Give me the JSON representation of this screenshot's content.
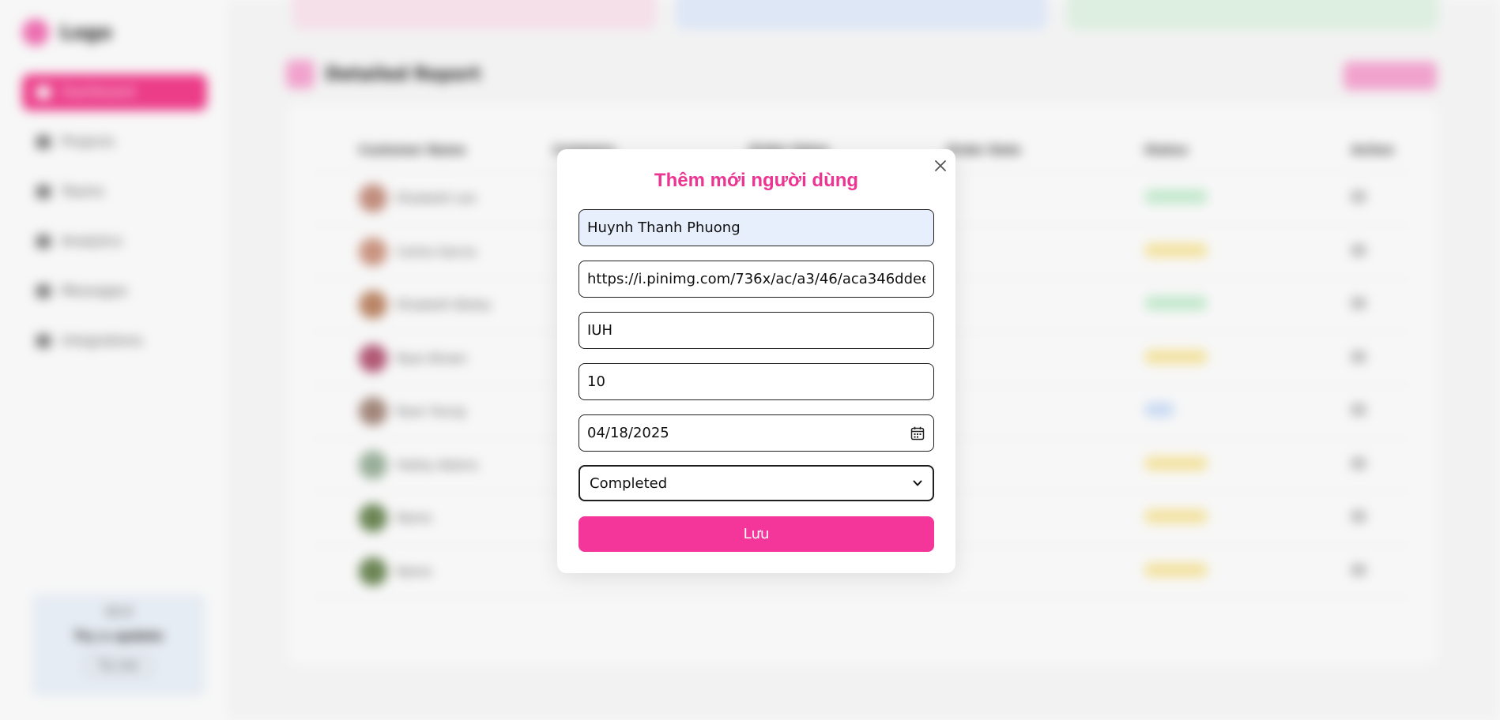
{
  "background": {
    "logo_text": "Logo",
    "nav_items": [
      "Dashboard",
      "Projects",
      "Teams",
      "Analytics",
      "Messages",
      "Integrations"
    ],
    "promo": {
      "title": "V2.0",
      "subtitle": "Try a update",
      "button": "Try now"
    },
    "section_title": "Detailed Report",
    "columns": [
      "",
      "Customer Name",
      "Company",
      "Order Value",
      "Order Date",
      "Status",
      "Action"
    ],
    "rows": [
      {
        "name": "Elizabeth Lee",
        "status": "green"
      },
      {
        "name": "Carlos Garcia",
        "status": "yellow"
      },
      {
        "name": "Elizabeth Bailey",
        "status": "green"
      },
      {
        "name": "Ryan Brown",
        "status": "yellow"
      },
      {
        "name": "Ryan Young",
        "status": "blue"
      },
      {
        "name": "Hailey Adams",
        "status": "yellow"
      },
      {
        "name": "Name",
        "status": "yellow"
      },
      {
        "name": "Name",
        "status": "yellow"
      }
    ]
  },
  "modal": {
    "title": "Thêm mới người dùng",
    "fields": {
      "name": "Huynh Thanh Phuong",
      "avatar_url": "https://i.pinimg.com/736x/ac/a3/46/aca346ddee1a0da",
      "company": "IUH",
      "value": "10",
      "date": "04/18/2025",
      "status": "Completed"
    },
    "save_label": "Lưu",
    "icons": {
      "close": "close-icon",
      "calendar": "calendar-icon",
      "dropdown": "chevron-down-icon"
    }
  },
  "colors": {
    "accent": "#f4359a",
    "title": "#ec3593",
    "filled_input": "#e8effc"
  }
}
